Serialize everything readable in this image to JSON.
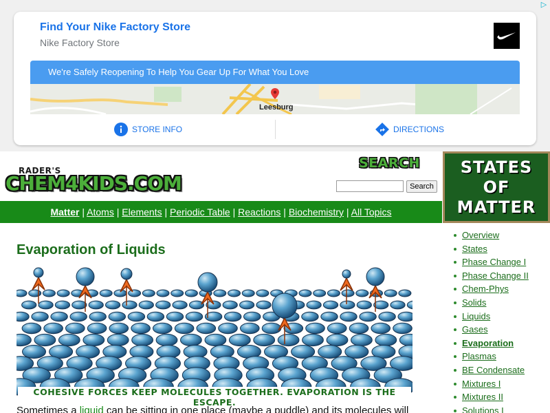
{
  "ad": {
    "corner_icon": "adchoices-icon",
    "title": "Find Your Nike Factory Store",
    "subtitle": "Nike Factory Store",
    "banner": "We're Safely Reopening To Help You Gear Up For What You Love",
    "map_label": "Leesburg",
    "store_info": "STORE INFO",
    "directions": "DIRECTIONS",
    "accent": "#1a73e8"
  },
  "header": {
    "logo_small": "RADER'S",
    "logo_big": "CHEM4KIDS.COM",
    "search_heading": "SEARCH",
    "search_value": "",
    "search_button": "Search",
    "section_badge_line1": "STATES",
    "section_badge_line2": "OF",
    "section_badge_line3": "MATTER"
  },
  "nav": {
    "items": [
      "Matter",
      "Atoms",
      "Elements",
      "Periodic Table",
      "Reactions",
      "Biochemistry",
      "All Topics"
    ],
    "separator": "|"
  },
  "main": {
    "title": "Evaporation of Liquids",
    "caption": "COHESIVE FORCES KEEP MOLECULES TOGETHER. EVAPORATION IS THE ESCAPE.",
    "body_start": "Sometimes a ",
    "body_link": "liquid",
    "body_rest": " can be sitting in one place (maybe a puddle) and its molecules will"
  },
  "sidebar": {
    "items": [
      "Overview",
      "States",
      "Phase Change I",
      "Phase Change II",
      "Chem-Phys",
      "Solids",
      "Liquids",
      "Gases",
      "Evaporation",
      "Plasmas",
      "BE Condensate",
      "Mixtures I",
      "Mixtures II",
      "Solutions I"
    ]
  },
  "colors": {
    "nav_green": "#188a18",
    "title_green": "#1b6d1b",
    "badge_green": "#1b5e20"
  }
}
